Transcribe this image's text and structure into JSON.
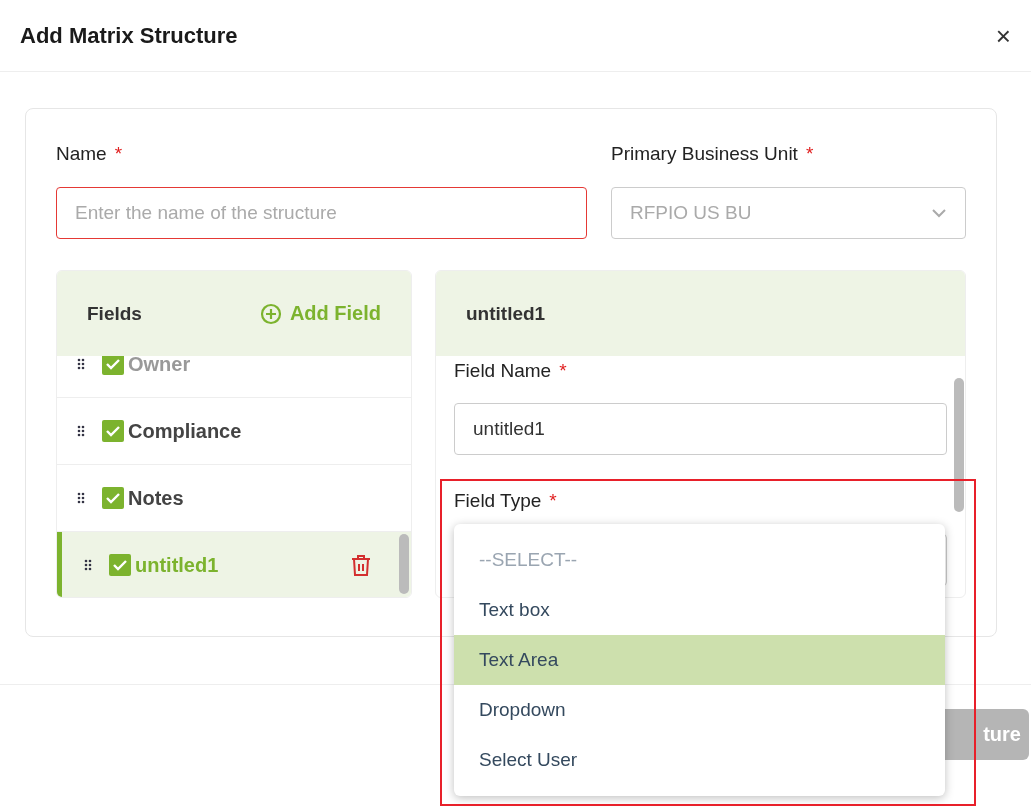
{
  "dialog": {
    "title": "Add Matrix Structure",
    "close": "×"
  },
  "name": {
    "label": "Name",
    "required": "*",
    "placeholder": "Enter the name of the structure",
    "error": true
  },
  "business_unit": {
    "label": "Primary Business Unit",
    "required": "*",
    "value": "RFPIO US BU"
  },
  "fields_panel": {
    "title": "Fields",
    "add_button": "Add Field",
    "items": [
      {
        "label": "Owner",
        "checked": true,
        "selected": false,
        "dimmed": true
      },
      {
        "label": "Compliance",
        "checked": true,
        "selected": false,
        "dimmed": false
      },
      {
        "label": "Notes",
        "checked": true,
        "selected": false,
        "dimmed": false
      },
      {
        "label": "untitled1",
        "checked": true,
        "selected": true,
        "dimmed": false
      }
    ]
  },
  "field_editor": {
    "title": "untitled1",
    "field_name_label": "Field Name",
    "field_name_required": "*",
    "field_name_value": "untitled1",
    "field_type_label": "Field Type",
    "field_type_required": "*"
  },
  "field_type_dropdown": {
    "options": [
      {
        "label": "--SELECT--",
        "kind": "placeholder",
        "selected": false
      },
      {
        "label": "Text box",
        "kind": "option",
        "selected": false
      },
      {
        "label": "Text Area",
        "kind": "option",
        "selected": true
      },
      {
        "label": "Dropdown",
        "kind": "option",
        "selected": false
      },
      {
        "label": "Select User",
        "kind": "option",
        "selected": false
      }
    ]
  },
  "footer": {
    "button": "ture"
  }
}
